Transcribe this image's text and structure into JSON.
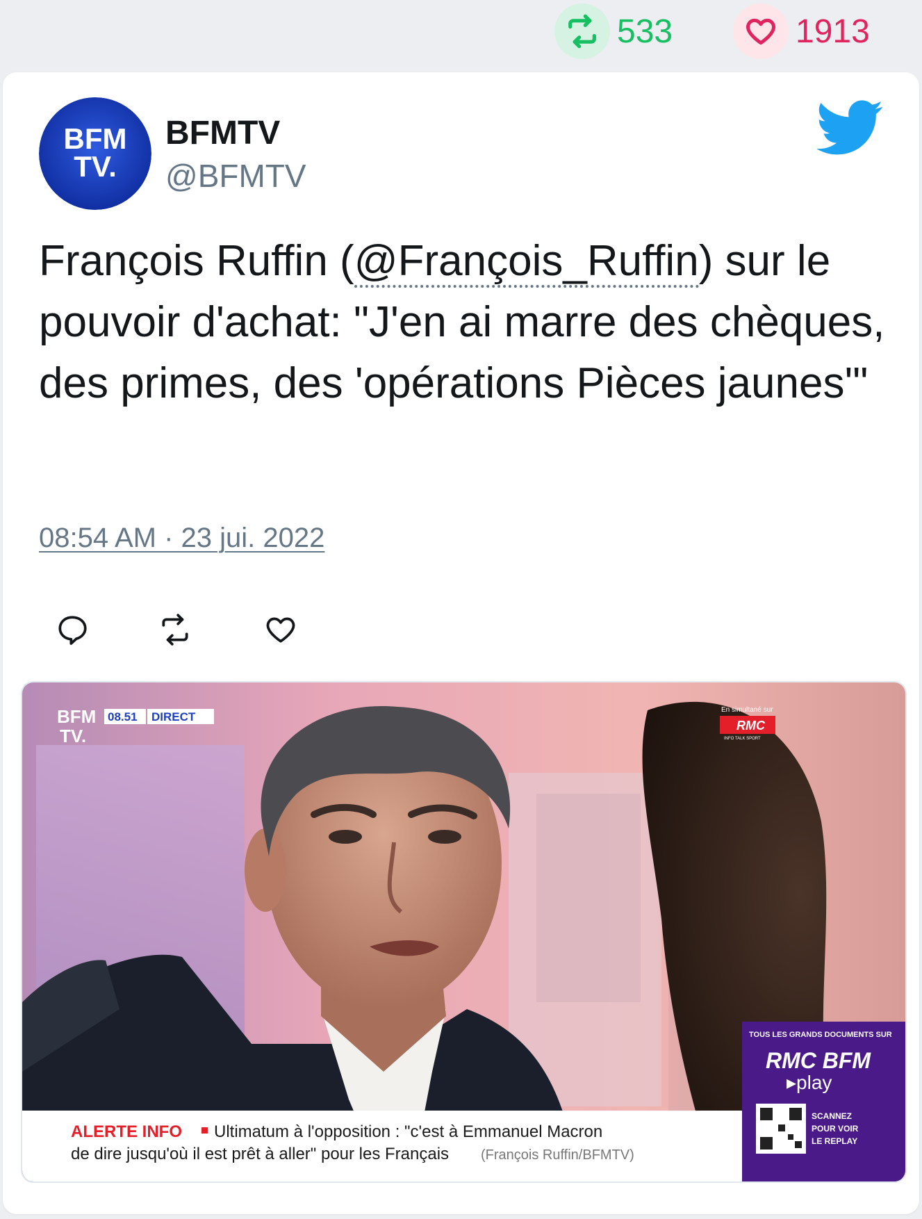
{
  "top_stats": {
    "retweets": "533",
    "likes": "1913"
  },
  "tweet": {
    "author_name": "BFMTV",
    "author_handle": "@BFMTV",
    "avatar_text_line1": "BFM",
    "avatar_text_line2": "TV.",
    "text_before": "François Ruffin (",
    "mention": "@François_Ruffin",
    "text_after": ") sur le pouvoir d'achat: \"J'en ai marre des chèques, des primes, des 'opérations Pièces jaunes'\"",
    "timestamp": "08:54 AM · 23 jui. 2022"
  },
  "media": {
    "logo_line1": "BFM",
    "logo_line2": "TV.",
    "clock": "08.51",
    "live_label": "DIRECT",
    "simulcast_label": "En simultané sur",
    "rmc_label": "RMC",
    "rmc_sub": "INFO TALK SPORT",
    "promo_header": "TOUS LES GRANDS DOCUMENTS SUR",
    "promo_brand": "RMC BFM",
    "promo_play": "▸play",
    "scan_line1": "SCANNEZ",
    "scan_line2": "POUR VOIR",
    "scan_line3": "LE REPLAY",
    "alert_label": "ALERTE INFO",
    "alert_line1": "Ultimatum à l'opposition : \"c'est à Emmanuel Macron",
    "alert_line2": "de dire jusqu'où il est prêt à aller\" pour les Français",
    "alert_credit": "(François Ruffin/BFMTV)"
  },
  "colors": {
    "retweet": "#17bf63",
    "like": "#e0245e",
    "twitter_blue": "#1da1f2",
    "bfm_blue": "#1e3fbf",
    "alert_red": "#e3202a",
    "promo_purple": "#4a1a88"
  },
  "icons": [
    "retweet-icon",
    "heart-icon",
    "twitter-bird-icon",
    "reply-icon"
  ]
}
